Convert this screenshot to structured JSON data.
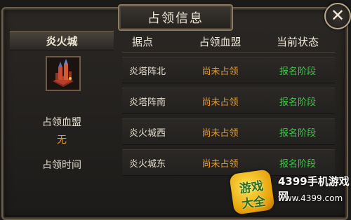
{
  "dialog": {
    "title": "占领信息",
    "close_label": "✕"
  },
  "city": {
    "name": "炎火城",
    "icon": "castle-tower-icon"
  },
  "occupation": {
    "alliance_label": "占领血盟",
    "alliance_value": "无",
    "time_label": "占领时间"
  },
  "table": {
    "headers": [
      "据点",
      "占领血盟",
      "当前状态"
    ],
    "rows": [
      {
        "stronghold": "炎塔阵北",
        "alliance": "尚未占领",
        "status": "报名阶段"
      },
      {
        "stronghold": "炎塔阵南",
        "alliance": "尚未占领",
        "status": "报名阶段"
      },
      {
        "stronghold": "炎火城西",
        "alliance": "尚未占领",
        "status": "报名阶段"
      },
      {
        "stronghold": "炎火城东",
        "alliance": "尚未占领",
        "status": "报名阶段"
      }
    ]
  },
  "watermark": {
    "logo_top": "游戏",
    "logo_bottom": "大全",
    "brand": "4399手机游戏网",
    "url": "www.4399.com"
  },
  "colors": {
    "status_green": "#3fc74a",
    "alliance_orange": "#e59a2a",
    "frame_gold": "#8c7b5f"
  }
}
